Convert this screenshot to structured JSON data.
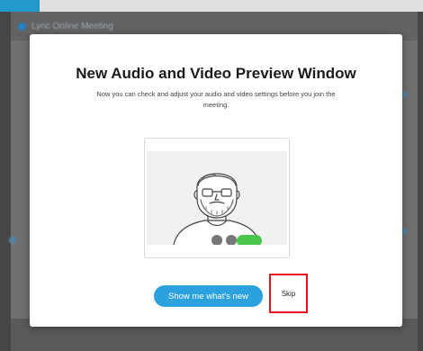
{
  "app": {
    "window_title": "Lync Online Meeting"
  },
  "dialog": {
    "title": "New Audio and Video Preview Window",
    "description": "Now you can check and adjust your audio and video settings before you join the meeting.",
    "primary_button_label": "Show me what's new",
    "skip_label": "Skip"
  },
  "illustration": {
    "subject": "avatar-with-beard",
    "controls": [
      "camera-toggle",
      "mic-toggle",
      "join-call"
    ]
  },
  "colors": {
    "accent": "#2ba1de",
    "join": "#4cc54b",
    "highlight": "#e8121c"
  }
}
